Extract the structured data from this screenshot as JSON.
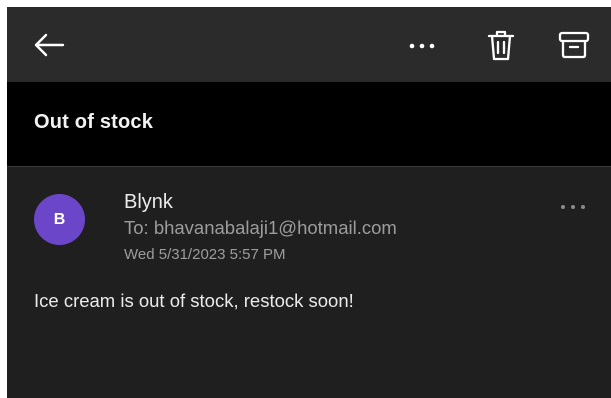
{
  "toolbar": {
    "back_icon": "arrow-left-icon",
    "more_icon": "more-horizontal-icon",
    "delete_icon": "trash-icon",
    "archive_icon": "archive-icon"
  },
  "email": {
    "subject": "Out of stock",
    "avatar_letter": "B",
    "sender": "Blynk",
    "recipient": "To: bhavanabalaji1@hotmail.com",
    "date": "Wed 5/31/2023 5:57 PM",
    "body": "Ice cream is out of stock, restock soon!"
  },
  "colors": {
    "toolbar_bg": "#2b2b2b",
    "subject_bg": "#000000",
    "message_bg": "#1f1f1f",
    "avatar": "#6b46c9",
    "primary_text": "#eaeaea",
    "secondary_text": "#9c9c9c"
  }
}
